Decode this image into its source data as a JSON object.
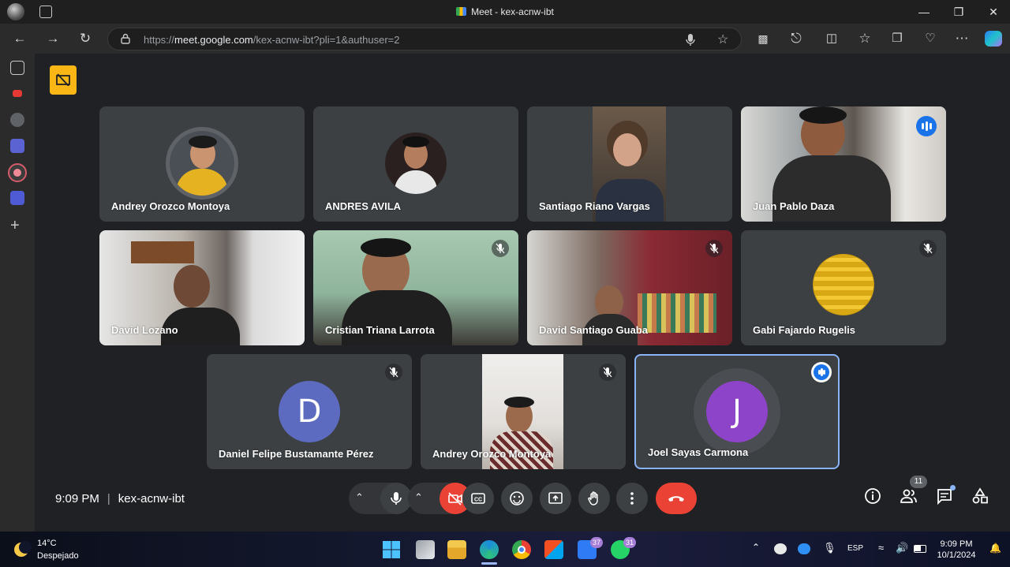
{
  "window": {
    "title": "Meet - kex-acnw-ibt"
  },
  "browser": {
    "url_prefix": "https://",
    "url_domain": "meet.google.com",
    "url_path": "/kex-acnw-ibt?pli=1&authuser=2"
  },
  "participants": [
    {
      "name": "Andrey Orozco Montoya",
      "muted": false,
      "display": "avatar-photo"
    },
    {
      "name": "ANDRES AVILA",
      "muted": false,
      "display": "avatar-photo"
    },
    {
      "name": "Santiago Riano Vargas",
      "muted": false,
      "display": "video"
    },
    {
      "name": "Juan Pablo Daza",
      "muted": false,
      "speaking": true,
      "display": "video"
    },
    {
      "name": "David Lozano",
      "muted": false,
      "display": "video"
    },
    {
      "name": "Cristian Triana Larrota",
      "muted": true,
      "display": "video"
    },
    {
      "name": "David Santiago Guaba",
      "muted": true,
      "display": "video"
    },
    {
      "name": "Gabi Fajardo Rugelis",
      "muted": true,
      "display": "avatar-image"
    },
    {
      "name": "Daniel Felipe Bustamante Pérez",
      "muted": true,
      "display": "initial",
      "initial": "D"
    },
    {
      "name": "Andrey Orozco Montoya",
      "muted": true,
      "display": "video"
    },
    {
      "name": "Joel Sayas Carmona",
      "muted": false,
      "speaking": true,
      "display": "initial",
      "initial": "J"
    }
  ],
  "meeting": {
    "time": "9:09 PM",
    "separator": "|",
    "code": "kex-acnw-ibt",
    "people_count": "11"
  },
  "taskbar": {
    "weather_temp": "14°C",
    "weather_condition": "Despejado",
    "edge_badge": "37",
    "whatsapp_badge": "31",
    "language": "ESP",
    "clock_time": "9:09 PM",
    "clock_date": "10/1/2024"
  },
  "colors": {
    "meet_background": "#202124",
    "tile_background": "#3c4043",
    "end_call": "#ea4335",
    "speaking_blue": "#1a73e8",
    "avatar_d": "#5c6bc0",
    "avatar_j": "#8e44c8"
  }
}
